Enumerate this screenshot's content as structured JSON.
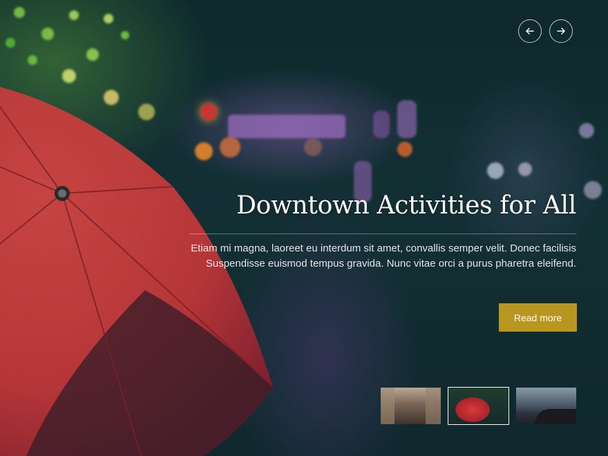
{
  "slide": {
    "title": "Downtown Activities for All",
    "description": "Etiam mi magna, laoreet eu interdum sit amet, convallis semper velit. Donec facilisis Suspendisse euismod tempus gravida. Nunc vitae orci a purus pharetra eleifend.",
    "button_label": "Read more"
  },
  "navigation": {
    "prev_icon": "arrow-left-icon",
    "next_icon": "arrow-right-icon"
  },
  "thumbnails": [
    {
      "name": "city-street-thumbnail",
      "active": false
    },
    {
      "name": "red-umbrella-thumbnail",
      "active": true
    },
    {
      "name": "seaside-rocks-thumbnail",
      "active": false
    }
  ],
  "colors": {
    "button_bg": "#b99620",
    "background": "#0d2a2e",
    "umbrella": "#d8403f"
  }
}
